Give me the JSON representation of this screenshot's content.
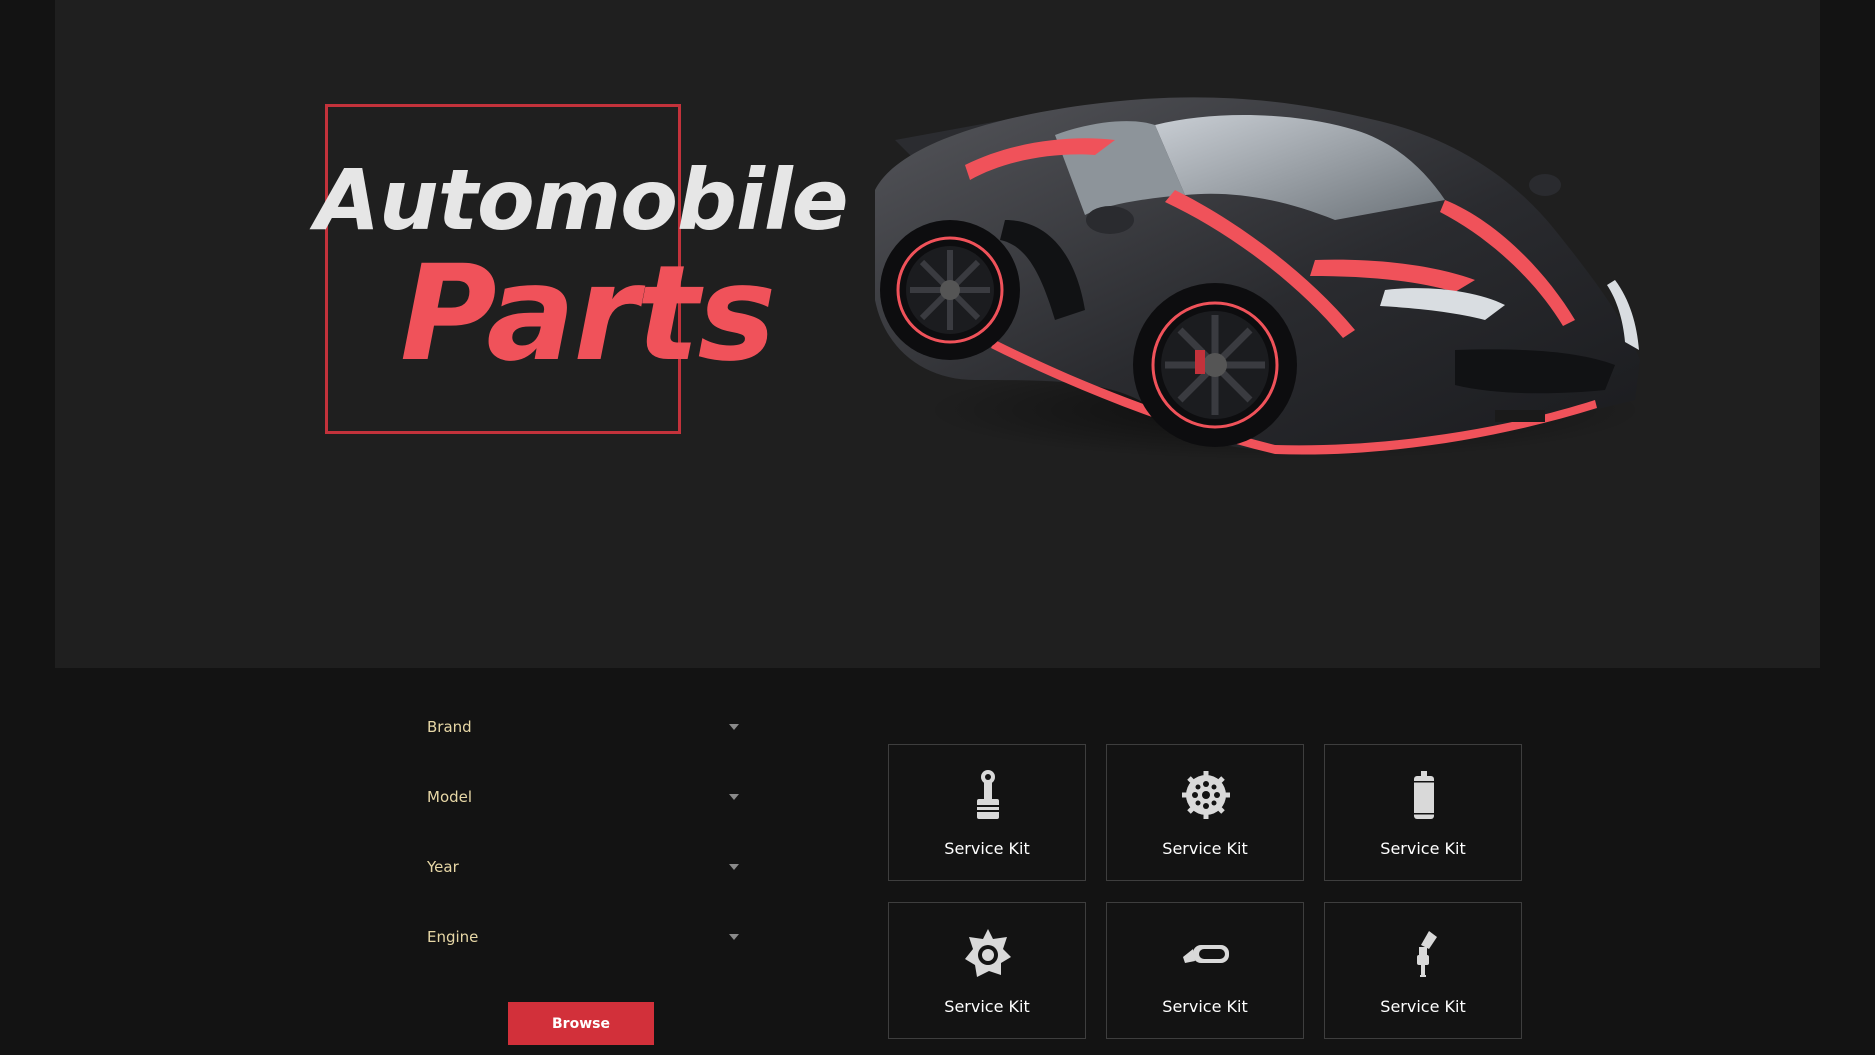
{
  "hero": {
    "title_line1": "Automobile",
    "title_line2": "Parts",
    "accent_color": "#f0525a",
    "frame_color": "#c3323b"
  },
  "filters": [
    {
      "label": "Brand"
    },
    {
      "label": "Model"
    },
    {
      "label": "Year"
    },
    {
      "label": "Engine"
    }
  ],
  "browse_label": "Browse",
  "kits": [
    {
      "label": "Service Kit",
      "icon": "piston-icon"
    },
    {
      "label": "Service Kit",
      "icon": "gear-icon"
    },
    {
      "label": "Service Kit",
      "icon": "oil-filter-icon"
    },
    {
      "label": "Service Kit",
      "icon": "wheel-hub-icon"
    },
    {
      "label": "Service Kit",
      "icon": "side-mirror-icon"
    },
    {
      "label": "Service Kit",
      "icon": "spark-plug-icon"
    }
  ]
}
